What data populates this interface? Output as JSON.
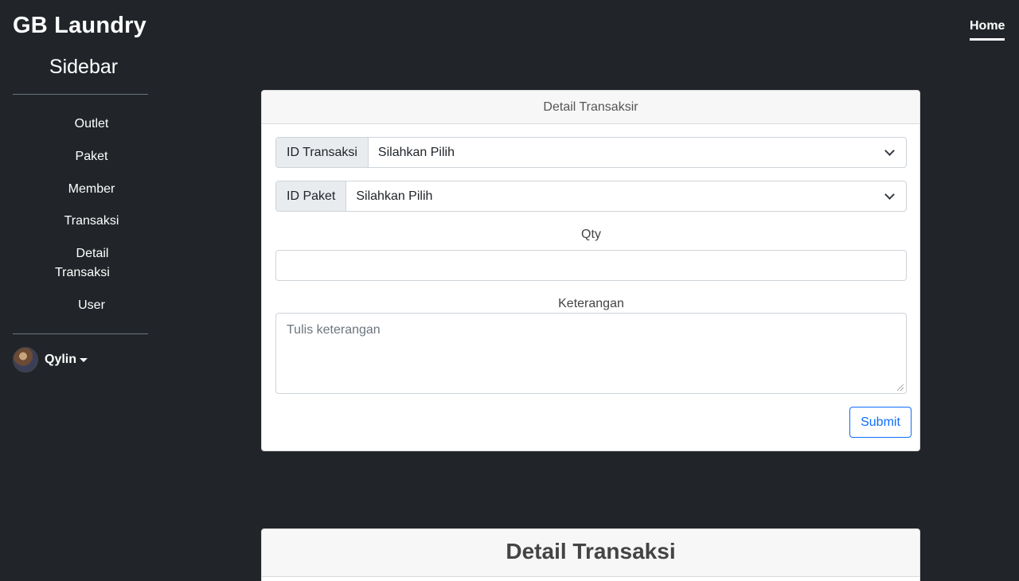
{
  "sidebar": {
    "brand": "GB Laundry",
    "title": "Sidebar",
    "items": [
      {
        "label": "Outlet"
      },
      {
        "label": "Paket"
      },
      {
        "label": "Member"
      },
      {
        "label": "Transaksi"
      },
      {
        "label_line1": "Detail",
        "label_line2": "Transaksi"
      },
      {
        "label": "User"
      }
    ],
    "user_name": "Qylin"
  },
  "topnav": {
    "home": "Home"
  },
  "form_card": {
    "header": "Detail Transaksir",
    "id_transaksi_label": "ID Transaksi",
    "id_transaksi_value": "Silahkan Pilih",
    "id_paket_label": "ID Paket",
    "id_paket_value": "Silahkan Pilih",
    "qty_label": "Qty",
    "qty_value": "",
    "keterangan_label": "Keterangan",
    "keterangan_placeholder": "Tulis keterangan",
    "submit_label": "Submit"
  },
  "table_card": {
    "header": "Detail Transaksi"
  }
}
